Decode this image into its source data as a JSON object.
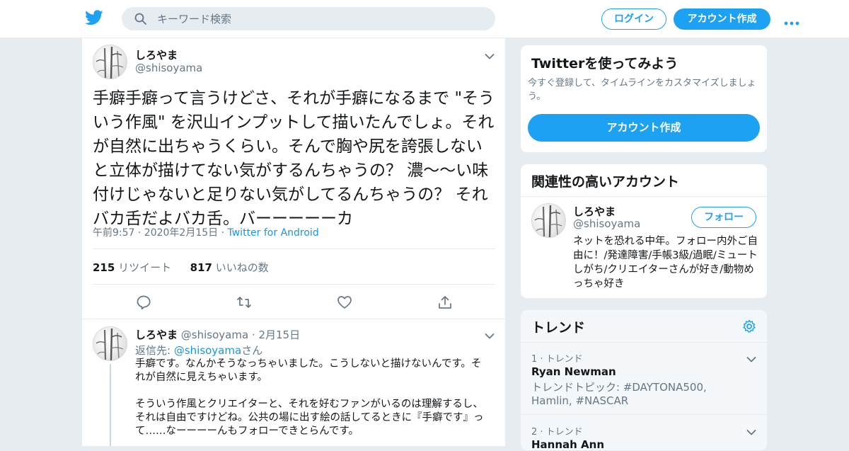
{
  "header": {
    "search_placeholder": "キーワード検索",
    "login_label": "ログイン",
    "signup_label": "アカウント作成"
  },
  "tweet": {
    "name": "しろやま",
    "handle": "@shisoyama",
    "text": "手癖手癖って言うけどさ、それが手癖になるまで \"そういう作風\" を沢山インプットして描いたんでしょ。それが自然に出ちゃうくらい。そんで胸や尻を誇張しないと立体が描けてない気がするんちゃうの？ 濃～～い味付けじゃないと足りない気がしてるんちゃうの？ それバカ舌だよバカ舌。バーーーーーカ",
    "time": "午前9:57 · 2020年2月15日",
    "separator": "·",
    "client": "Twitter for Android",
    "retweet_count": "215",
    "retweet_label": "リツイート",
    "like_count": "817",
    "like_label": "いいねの数"
  },
  "reply": {
    "name": "しろやま",
    "handle": "@shisoyama",
    "date": "· 2月15日",
    "reply_to_prefix": "返信先: ",
    "reply_to_mention": "@shisoyama",
    "reply_to_suffix": "さん",
    "text": "手癖です。なんかそうなっちゃいました。こうしないと描けないんです。それが自然に見えちゃいます。\n\nそういう作風とクリエイターと、それを好むファンがいるのは理解するし、それは自由ですけどね。公共の場に出す絵の話してるときに『手癖です』って……なーーーーんもフォローできとらんです。"
  },
  "signup_card": {
    "title": "Twitterを使ってみよう",
    "subtitle": "今すぐ登録して、タイムラインをカスタマイズしましょう。",
    "button_label": "アカウント作成"
  },
  "related_card": {
    "title": "関連性の高いアカウント",
    "name": "しろやま",
    "handle": "@shisoyama",
    "follow_label": "フォロー",
    "bio": "ネットを恐れる中年。フォロー内外ご自由に！/発達障害/手帳3級/過眠/ミュートしがち/クリエイターさんが好き/動物めっちゃ好き"
  },
  "trends_card": {
    "title": "トレンド",
    "items": [
      {
        "meta": "1 · トレンド",
        "name": "Ryan Newman",
        "desc": "トレンドトピック: #DAYTONA500, Hamlin, #NASCAR"
      },
      {
        "meta": "2 · トレンド",
        "name": "Hannah Ann",
        "desc": ""
      }
    ]
  },
  "colors": {
    "accent": "#1da1f2",
    "link": "#1b95e0",
    "muted": "#657786",
    "background": "#e6ecf0"
  },
  "icons": [
    "twitter-logo-icon",
    "search-icon",
    "more-dots-icon",
    "chevron-down-icon",
    "reply-icon",
    "retweet-icon",
    "like-icon",
    "share-icon",
    "gear-icon"
  ]
}
